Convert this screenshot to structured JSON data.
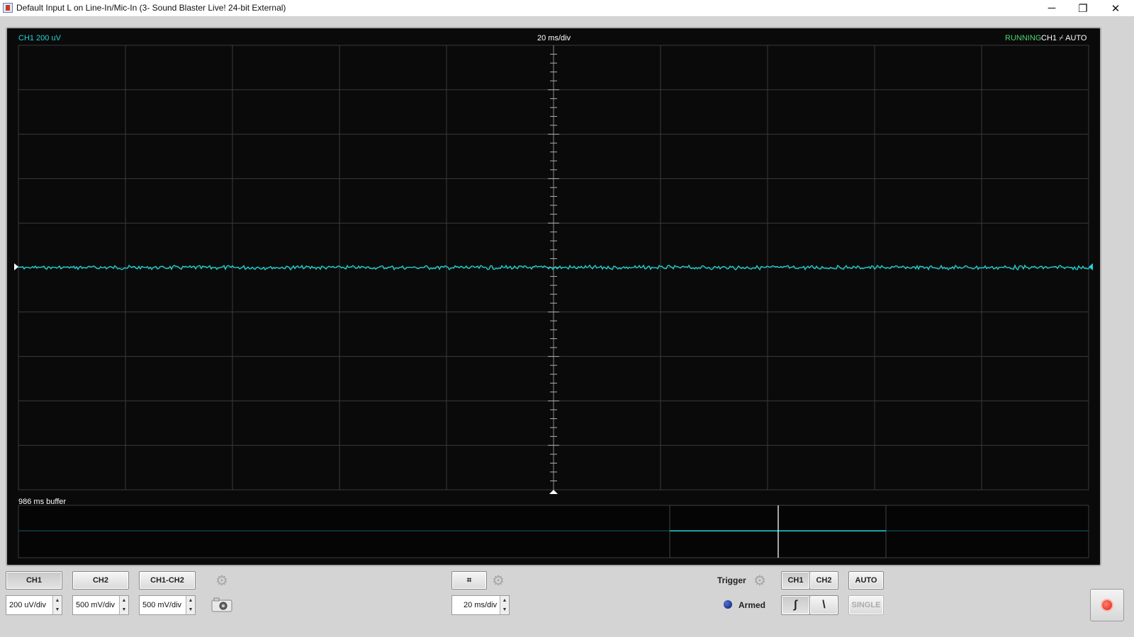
{
  "window": {
    "title": "Default Input L on Line-In/Mic-In (3- Sound Blaster Live! 24-bit External)",
    "minimize_glyph": "─",
    "restore_glyph": "❐",
    "close_glyph": "✕"
  },
  "scope": {
    "channel_scale_label": "CH1 200 uV",
    "timebase_label": "20 ms/div",
    "status": "RUNNING",
    "trigger_info": "CH1 ⌿ AUTO",
    "buffer_label": "986 ms buffer",
    "trace_color": "#1fd6d6",
    "grid_color": "#3a3a3a",
    "divisions_horizontal": 10,
    "divisions_vertical": 10
  },
  "controls": {
    "channel_buttons": [
      "CH1",
      "CH2",
      "CH1-CH2"
    ],
    "ch1_scale": "200 uV/div",
    "ch2_scale": "500 mV/div",
    "diff_scale": "500 mV/div",
    "timebase_value": "20 ms/div",
    "trigger_label": "Trigger",
    "trigger_source_ch1": "CH1",
    "trigger_source_ch2": "CH2",
    "trigger_mode_auto": "AUTO",
    "trigger_mode_single": "SINGLE",
    "armed_label": "Armed",
    "rising_edge_glyph": "∫",
    "falling_edge_glyph": "\\"
  },
  "icons": {
    "gear": "⚙",
    "grid": "⌗",
    "camera": "camera-icon",
    "record": "record-icon"
  }
}
